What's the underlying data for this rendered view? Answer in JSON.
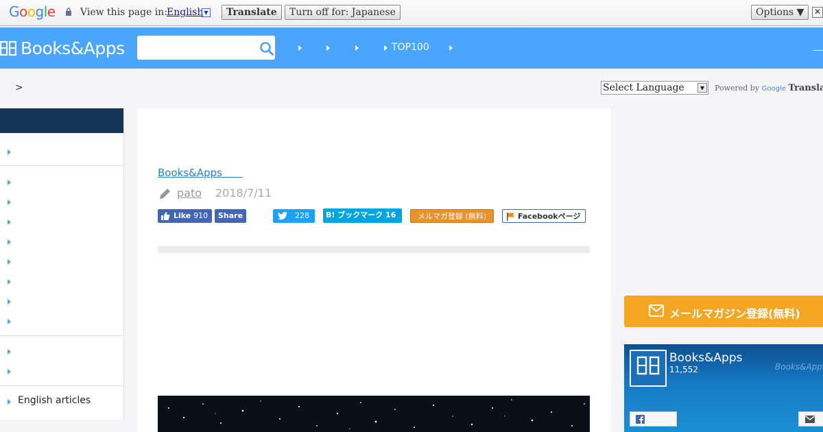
{
  "translate_bar": {
    "logo": "Google",
    "view_label": "View this page in:",
    "language": "English",
    "translate_button": "Translate",
    "turn_off_button": "Turn off for: Japanese",
    "options_button": "Options ▼",
    "close_glyph": "✕"
  },
  "header": {
    "logo": "Books&Apps",
    "search_placeholder": "",
    "nav_label": "TOP100"
  },
  "breadcrumb": ">",
  "translate_widget": {
    "select_value": "Select Language",
    "powered_by": "Powered by",
    "google": "Google",
    "translate": "Translate"
  },
  "sidebar": {
    "english_link": "English articles"
  },
  "article": {
    "category": "Books&Apps　　",
    "author": "pato",
    "date": "2018/7/11",
    "share": {
      "like_label": "Like",
      "like_count": "910",
      "share_label": "Share",
      "tweet_count": "228",
      "hatena_label": "B! ブックマーク 16",
      "newsletter_label": "メルマガ登録 (無料)",
      "facebook_page_label": "Facebookページ"
    }
  },
  "right": {
    "mail_button": "メールマガジン登録(無料)",
    "fb_page_name": "Books&Apps",
    "fb_likes": "11,552",
    "fb_watermark": "Books&Apps"
  },
  "colors": {
    "header_blue": "#4aa5fc",
    "sidebar_head": "#123557",
    "facebook_blue": "#4267b2",
    "twitter_blue": "#1da1f2",
    "hatena_blue": "#00a4de",
    "mail_orange": "#f5a623"
  }
}
